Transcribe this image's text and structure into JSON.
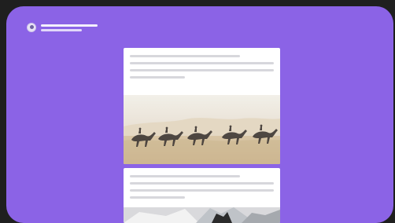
{
  "header": {
    "avatar_icon": "user-avatar-icon"
  },
  "feed": {
    "posts": [
      {
        "image_semantic": "desert-camel-caravan-photo"
      },
      {
        "image_semantic": "partial-photo"
      }
    ]
  },
  "colors": {
    "background": "#8b63e6",
    "card": "#ffffff",
    "placeholder_line": "#d7d7dc"
  }
}
